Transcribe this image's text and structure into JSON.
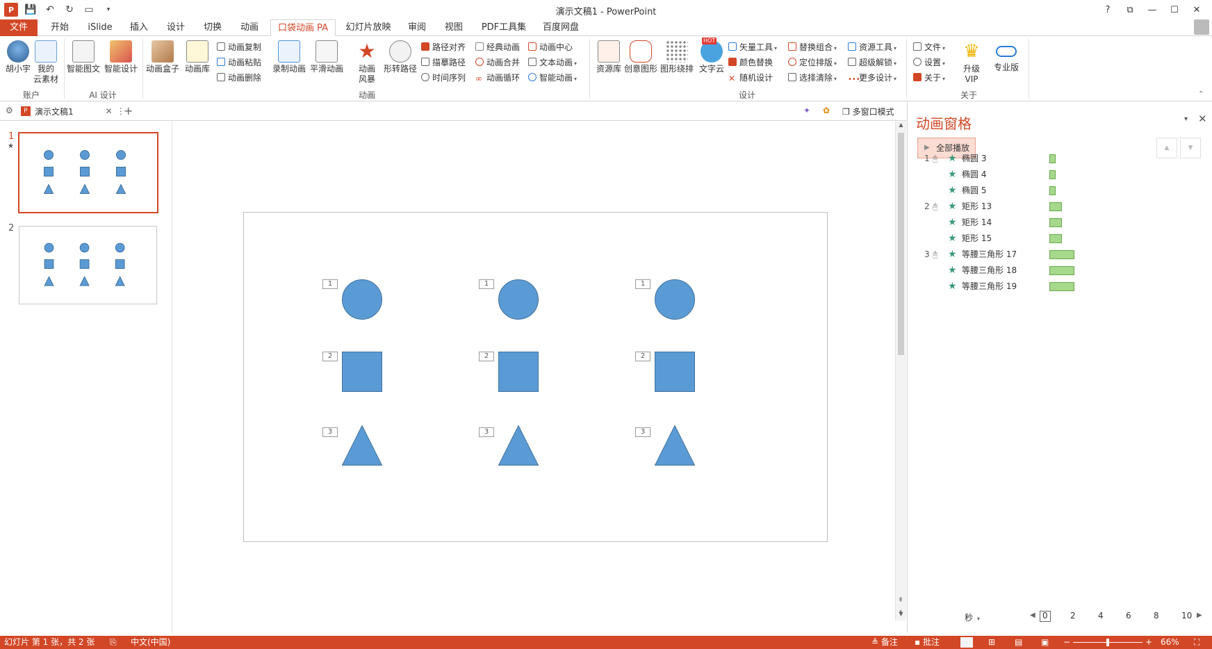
{
  "window": {
    "title": "演示文稿1 - PowerPoint",
    "controls": [
      "?",
      "⧉",
      "—",
      "☐",
      "✕"
    ]
  },
  "tabs": [
    "文件",
    "开始",
    "iSlide",
    "插入",
    "设计",
    "切换",
    "动画",
    "口袋动画 PA",
    "幻灯片放映",
    "审阅",
    "视图",
    "PDF工具集",
    "百度网盘"
  ],
  "active_tab": "口袋动画 PA",
  "ribbon": {
    "groups": {
      "account": "账户",
      "ai_design": "AI 设计",
      "animation": "动画",
      "design": "设计",
      "about": "关于"
    },
    "buttons": {
      "user": "胡小宇",
      "my_cloud_1": "我的",
      "my_cloud_2": "云素材",
      "smart_image": "智能图文",
      "smart_design": "智能设计",
      "anim_box": "动画盒子",
      "anim_lib": "动画库",
      "anim_copy": "动画复制",
      "anim_paste": "动画粘贴",
      "anim_delete": "动画删除",
      "record_anim": "录制动画",
      "smooth_anim": "平滑动画",
      "anim_storm_1": "动画",
      "anim_storm_2": "风暴",
      "shape_path": "形转路径",
      "path_align": "路径对齐",
      "trace_path": "描摹路径",
      "time_seq": "时间序列",
      "classic_anim": "经典动画",
      "anim_merge": "动画合并",
      "anim_loop": "动画循环",
      "anim_center": "动画中心",
      "text_anim": "文本动画",
      "smart_anim": "智能动画",
      "resource_lib": "资源库",
      "creative_shape": "创意图形",
      "shape_layout": "图形绕排",
      "word_cloud": "文字云",
      "hot_badge": "HOT",
      "vector_tool": "矢量工具",
      "color_replace": "颜色替换",
      "random_design": "随机设计",
      "replace_group": "替换组合",
      "position_layout": "定位排版",
      "select_clear": "选择清除",
      "resource_tool": "资源工具",
      "super_unlock": "超级解锁",
      "more_design": "更多设计",
      "file": "文件",
      "settings": "设置",
      "about": "关于",
      "upgrade_1": "升级",
      "upgrade_2": "VIP",
      "pro": "专业版"
    }
  },
  "doc_strip": {
    "doc_tab": "演示文稿1",
    "multi_window": "多窗口模式"
  },
  "slides": [
    {
      "number": "1",
      "marker": "★"
    },
    {
      "number": "2"
    }
  ],
  "slide_tags": [
    "1",
    "2",
    "3"
  ],
  "anim_pane": {
    "title": "动画窗格",
    "play_all": "全部播放",
    "items": [
      {
        "num": "1",
        "name": "椭圆 3",
        "bar_start": 0,
        "bar_len": 0.5
      },
      {
        "num": "",
        "name": "椭圆 4",
        "bar_start": 0,
        "bar_len": 0.5
      },
      {
        "num": "",
        "name": "椭圆 5",
        "bar_start": 0,
        "bar_len": 0.5
      },
      {
        "num": "2",
        "name": "矩形 13",
        "bar_start": 0,
        "bar_len": 1
      },
      {
        "num": "",
        "name": "矩形 14",
        "bar_start": 0,
        "bar_len": 1
      },
      {
        "num": "",
        "name": "矩形 15",
        "bar_start": 0,
        "bar_len": 1
      },
      {
        "num": "3",
        "name": "等腰三角形 17",
        "bar_start": 0,
        "bar_len": 2
      },
      {
        "num": "",
        "name": "等腰三角形 18",
        "bar_start": 0,
        "bar_len": 2
      },
      {
        "num": "",
        "name": "等腰三角形 19",
        "bar_start": 0,
        "bar_len": 2
      }
    ],
    "timeline_unit": "秒",
    "timeline_ticks": [
      "0",
      "2",
      "4",
      "6",
      "8",
      "10"
    ]
  },
  "status": {
    "slide_info": "幻灯片 第 1 张，共 2 张",
    "language": "中文(中国)",
    "notes": "备注",
    "comments": "批注",
    "zoom": "66%"
  },
  "colors": {
    "accent": "#d24726",
    "shape_fill": "#5b9bd5",
    "shape_stroke": "#41719c",
    "bar_fill": "#a6d98c"
  }
}
